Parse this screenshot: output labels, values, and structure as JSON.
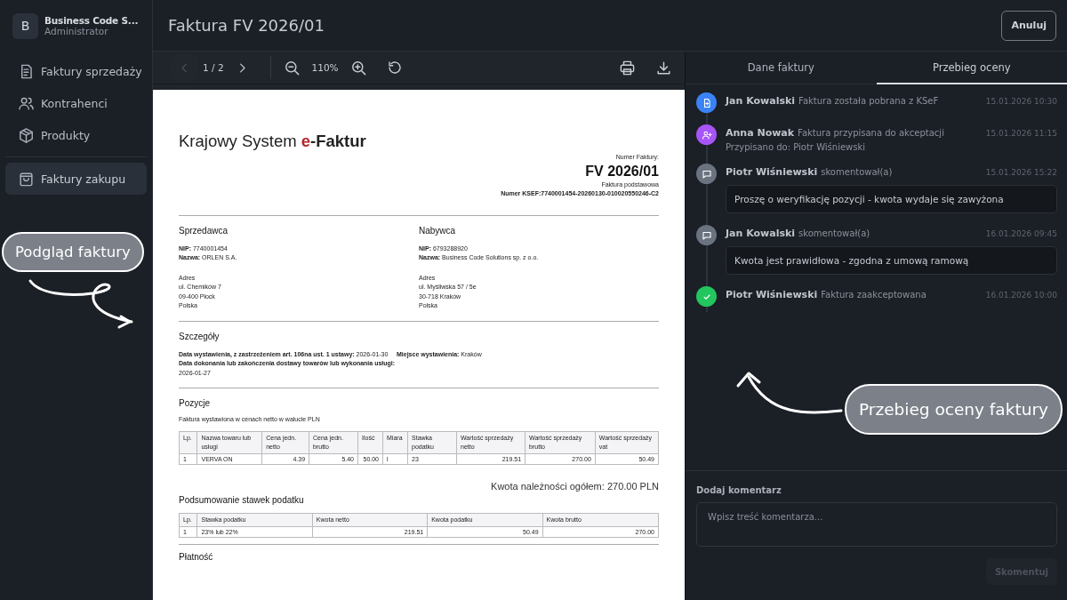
{
  "sidebar": {
    "brand": {
      "initial": "B",
      "name": "Business Code S...",
      "role": "Administrator"
    },
    "items": [
      {
        "label": "Faktury sprzedaży",
        "kind": "document",
        "selected": false
      },
      {
        "label": "Kontrahenci",
        "kind": "users",
        "selected": false
      },
      {
        "label": "Produkty",
        "kind": "box",
        "selected": false
      },
      {
        "label": "Faktury zakupu",
        "kind": "bag",
        "selected": true
      }
    ]
  },
  "header": {
    "title": "Faktura FV 2026/01",
    "cancel_button": "Anuluj"
  },
  "viewer": {
    "page_indicator": "1 / 2",
    "zoom": "110%",
    "prev_disabled": true
  },
  "invoice": {
    "system_title": "Krajowy System **e-Faktur**",
    "number_label": "Numer Faktury:",
    "number": "FV 2026/01",
    "invoice_type": "Faktura podstawowa",
    "ksef": "Numer KSEF:7740001454-20260130-010020550246-C2",
    "parties": [
      {
        "heading": "Sprzedawca",
        "lines": [
          "**NIP:** 7740001454",
          "**Nazwa:** ORLEN S.A."
        ],
        "address_label": "Adres",
        "address": [
          "ul. Chemików 7",
          "09-400 Płock",
          "Polska"
        ]
      },
      {
        "heading": "Nabywca",
        "lines": [
          "**NIP:** 6793288920",
          "**Nazwa:** Business Code Solutions sp. z o.o."
        ],
        "address_label": "Adres",
        "address": [
          "ul. Myśliwska 57 / 5e",
          "30-718 Kraków",
          "Polska"
        ]
      }
    ],
    "details": {
      "heading": "Szczegóły",
      "left": [
        "**Data wystawienia, z zastrzeżeniem art. 106na ust. 1 ustawy:** 2026-01-30",
        "**Data dokonania lub zakończenia dostawy towarów lub wykonania usługi:** 2026-01-27"
      ],
      "right": [
        "**Miejsce wystawienia:** Kraków"
      ]
    },
    "positions": {
      "heading": "Pozycje",
      "note": "Faktura wystawiona w cenach netto w walucie PLN",
      "columns": [
        "Lp.",
        "Nazwa towaru lub usługi",
        "Cena jedn. netto",
        "Cena jedn. brutto",
        "Ilość",
        "Miara",
        "Stawka podatku",
        "Wartość sprzedaży netto",
        "Wartość sprzedaży brutto",
        "Wartość sprzedaży vat"
      ],
      "rows": [
        [
          "1",
          "VERVA ON",
          "4.39",
          "5.40",
          "50.00",
          "l",
          "23",
          "219.51",
          "270.00",
          "50.49"
        ]
      ]
    },
    "total": "Kwota należności ogółem: 270.00 PLN",
    "tax_summary": {
      "heading": "Podsumowanie stawek podatku",
      "columns": [
        "Lp.",
        "Stawka podatku",
        "Kwota netto",
        "Kwota podatku",
        "Kwota brutto"
      ],
      "rows": [
        [
          "1",
          "23% lub 22%",
          "219.51",
          "50.49",
          "270.00"
        ]
      ]
    },
    "payment_heading": "Płatność"
  },
  "review": {
    "tabs": [
      {
        "label": "Dane faktury",
        "selected": false
      },
      {
        "label": "Przebieg oceny",
        "selected": true
      }
    ],
    "events": [
      {
        "kind": "document",
        "color": "#3b82f6",
        "author": "Jan Kowalski",
        "action": "Faktura została pobrana z KSeF",
        "time": "15.01.2026 10:30"
      },
      {
        "kind": "assign",
        "color": "#a855f7",
        "author": "Anna Nowak",
        "action": "Faktura przypisana do akceptacji",
        "detail": "Przypisano do: Piotr Wiśniewski",
        "time": "15.01.2026 11:15"
      },
      {
        "kind": "comment",
        "color": "#6b7280",
        "author": "Piotr Wiśniewski",
        "action": "skomentował(a)",
        "comment": "Proszę o weryfikację pozycji - kwota wydaje się zawyżona",
        "time": "15.01.2026 15:22"
      },
      {
        "kind": "comment",
        "color": "#6b7280",
        "author": "Jan Kowalski",
        "action": "skomentował(a)",
        "comment": "Kwota jest prawidłowa - zgodna z umową ramową",
        "time": "16.01.2026 09:45"
      },
      {
        "kind": "approved",
        "color": "#22c55e",
        "author": "Piotr Wiśniewski",
        "action": "Faktura zaakceptowana",
        "time": "16.01.2026 10:00"
      }
    ],
    "comment_form": {
      "label": "Dodaj komentarz",
      "placeholder": "Wpisz treść komentarza...",
      "button": "Skomentuj",
      "button_disabled": true
    }
  },
  "callouts": [
    {
      "text": "Podgląd faktury"
    },
    {
      "text": "Przebieg oceny faktury"
    }
  ]
}
